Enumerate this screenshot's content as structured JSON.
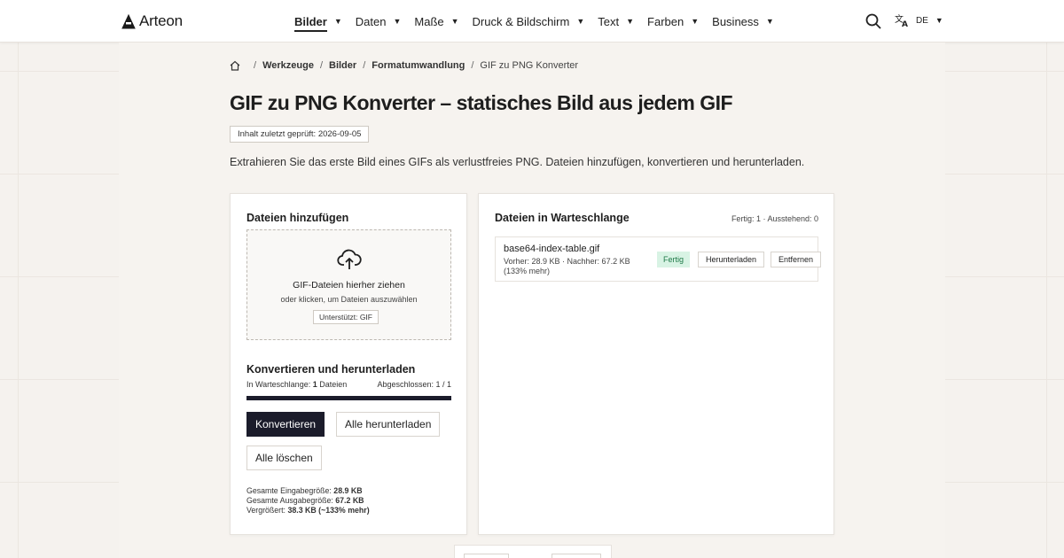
{
  "brand": {
    "name": "Arteon"
  },
  "nav": {
    "items": [
      {
        "label": "Bilder",
        "active": true
      },
      {
        "label": "Daten"
      },
      {
        "label": "Maße"
      },
      {
        "label": "Druck & Bildschirm"
      },
      {
        "label": "Text"
      },
      {
        "label": "Farben"
      },
      {
        "label": "Business"
      }
    ],
    "caret": "▼",
    "language": "DE"
  },
  "breadcrumb": {
    "items": [
      "Werkzeuge",
      "Bilder",
      "Formatumwandlung"
    ],
    "current": "GIF zu PNG Konverter",
    "separator": "/"
  },
  "page": {
    "title": "GIF zu PNG Konverter – statisches Bild aus jedem GIF",
    "reviewed": "Inhalt zuletzt geprüft: 2026-09-05",
    "intro": "Extrahieren Sie das erste Bild eines GIFs als verlustfreies PNG. Dateien hinzufügen, konvertieren und herunterladen."
  },
  "add_panel": {
    "title": "Dateien hinzufügen",
    "drop_title": "GIF-Dateien hierher ziehen",
    "drop_sub": "oder klicken, um Dateien auszuwählen",
    "supports": "Unterstützt: GIF"
  },
  "convert_panel": {
    "title": "Konvertieren und herunterladen",
    "queued_label": "In Warteschlange:",
    "queued_count": "1",
    "queued_unit": "Dateien",
    "completed": "Abgeschlossen: 1 / 1",
    "progress": 1.0,
    "convert_btn": "Konvertieren",
    "download_all_btn": "Alle herunterladen",
    "clear_btn": "Alle löschen",
    "totals": {
      "input_label": "Gesamte Eingabegröße:",
      "input_value": "28.9 KB",
      "output_label": "Gesamte Ausgabegröße:",
      "output_value": "67.2 KB",
      "growth_label": "Vergrößert:",
      "growth_value": "38.3 KB (~133% mehr)"
    }
  },
  "queue_panel": {
    "title": "Dateien in Warteschlange",
    "status": "Fertig: 1 · Ausstehend: 0",
    "files": [
      {
        "name": "base64-index-table.gif",
        "meta": "Vorher: 28.9 KB · Nachher: 67.2 KB (133% mehr)",
        "status": "Fertig",
        "download": "Herunterladen",
        "remove": "Entfernen"
      }
    ]
  },
  "colors": {
    "accent": "#1b1c2b",
    "success_bg": "#d8f3e4",
    "success_text": "#1f7a48",
    "page_bg": "#f5f2ee"
  },
  "icons": [
    "arteon-logo-icon",
    "search-icon",
    "translate-icon",
    "home-icon",
    "cloud-upload-icon"
  ]
}
